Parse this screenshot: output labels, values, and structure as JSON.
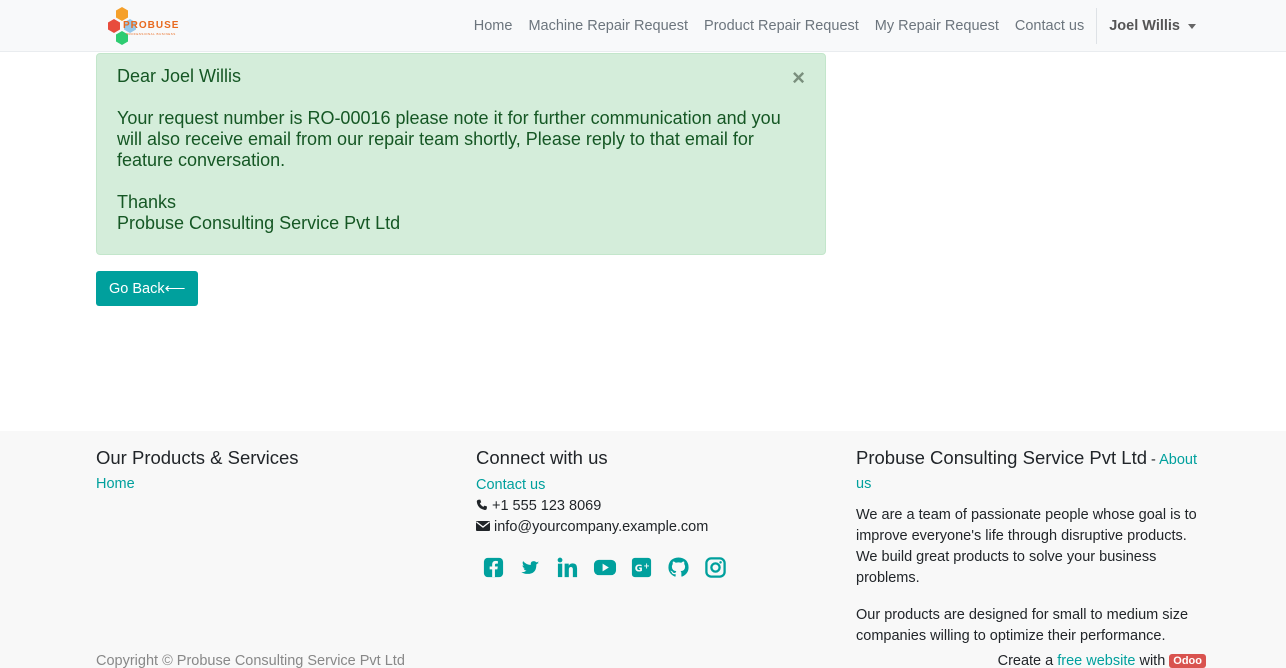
{
  "brand": {
    "logo_text": "PROBUSE",
    "logo_subtext": "PROFESSIONAL BUSINESS"
  },
  "nav": {
    "items": [
      {
        "label": "Home"
      },
      {
        "label": "Machine Repair Request"
      },
      {
        "label": "Product Repair Request"
      },
      {
        "label": "My Repair Request"
      },
      {
        "label": "Contact us"
      }
    ],
    "user": "Joel Willis"
  },
  "alert": {
    "greeting": "Dear Joel Willis",
    "message": "Your request number is RO-00016 please note it for further communication and you will also receive email from our repair team shortly, Please reply to that email for feature conversation.",
    "thanks": "Thanks",
    "signature": "Probuse Consulting Service Pvt Ltd",
    "close_symbol": "×"
  },
  "back_button": {
    "label": "Go Back⟵"
  },
  "footer": {
    "products": {
      "heading": "Our Products & Services",
      "links": [
        "Home"
      ]
    },
    "connect": {
      "heading": "Connect with us",
      "contact_link": "Contact us",
      "phone": "+1 555 123 8069",
      "email": "info@yourcompany.example.com",
      "social_icons": [
        "facebook-icon",
        "twitter-icon",
        "linkedin-icon",
        "youtube-icon",
        "google-plus-icon",
        "github-icon",
        "instagram-icon"
      ]
    },
    "about": {
      "company": "Probuse Consulting Service Pvt Ltd",
      "separator": " - ",
      "about_link": "About us",
      "para1": "We are a team of passionate people whose goal is to improve everyone's life through disruptive products. We build great products to solve your business problems.",
      "para2": "Our products are designed for small to medium size companies willing to optimize their performance."
    },
    "copyright": "Copyright © Probuse Consulting Service Pvt Ltd",
    "create_prefix": "Create a ",
    "create_link": "free website",
    "create_suffix": " with ",
    "odoo_badge": "Odoo"
  },
  "colors": {
    "accent": "#00a09d",
    "alert_bg": "#d4edda",
    "alert_text": "#155724",
    "footer_bg": "#f8f8f8"
  }
}
